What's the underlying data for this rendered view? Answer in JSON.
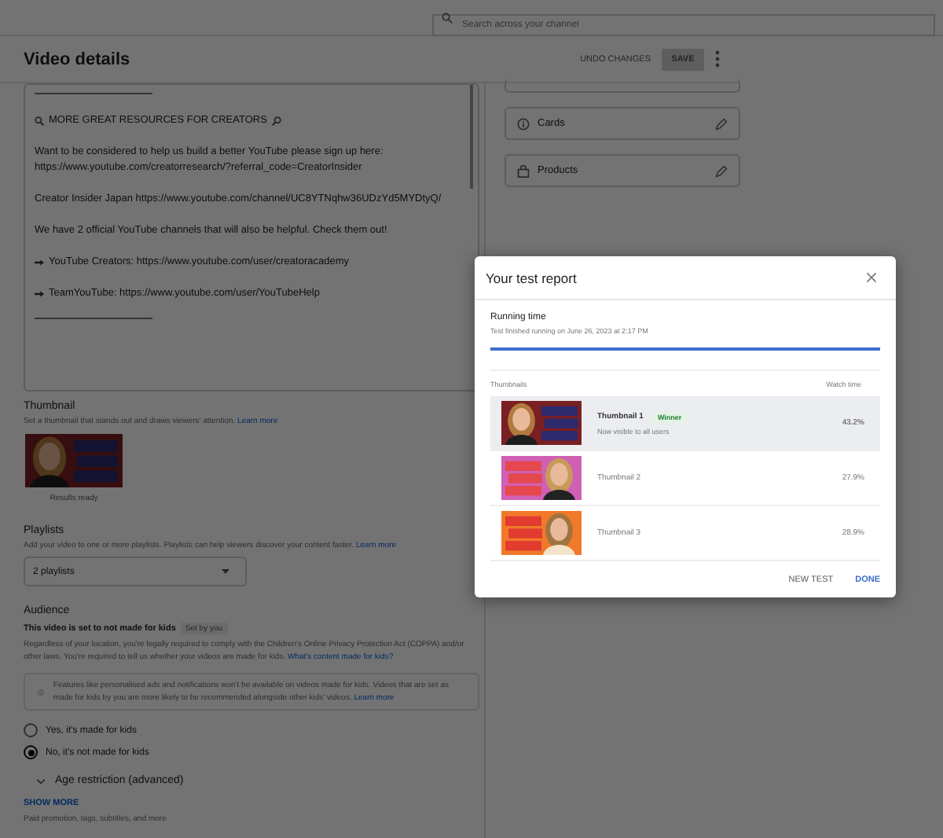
{
  "top_bar": {
    "search": {
      "placeholder": "Search across your channel"
    }
  },
  "header": {
    "title": "Video details",
    "undo": "UNDO CHANGES",
    "save": {
      "label": "SAVE",
      "disabled": true
    }
  },
  "description": {
    "paragraphs": [
      {
        "kind": "rule"
      },
      {
        "kind": "heading",
        "text": "MORE GREAT RESOURCES FOR CREATORS"
      },
      {
        "kind": "text",
        "lines": [
          "Want to be considered to help us build a better YouTube please sign up here:",
          "https://www.youtube.com/creatorresearch/?referral_code=CreatorInsider"
        ]
      },
      {
        "kind": "text",
        "lines": [
          "Creator Insider Japan https://www.youtube.com/channel/UC8YTNqhw36UDzYd5MYDtyQ/"
        ]
      },
      {
        "kind": "text",
        "lines": [
          "We have 2 official YouTube channels that will also be helpful. Check them out!"
        ]
      },
      {
        "kind": "bullet",
        "text": "YouTube Creators: https://www.youtube.com/user/creatoracademy"
      },
      {
        "kind": "bullet",
        "text": "TeamYouTube: https://www.youtube.com/user/YouTubeHelp"
      },
      {
        "kind": "rule"
      }
    ]
  },
  "side_cards": [
    {
      "kind": "cards",
      "label": "Cards"
    },
    {
      "kind": "products",
      "label": "Products"
    }
  ],
  "thumbnail": {
    "title": "Thumbnail",
    "hint": "Set a thumbnail that stands out and draws viewers' attention.",
    "link": "Learn more",
    "status": "Results ready"
  },
  "playlists": {
    "title": "Playlists",
    "hint": "Add your video to one or more playlists. Playlists can help viewers discover your content faster.",
    "link": "Learn more",
    "value": "2 playlists"
  },
  "audience": {
    "title": "Audience",
    "status": "This video is set to not made for kids",
    "badge": "Set by you",
    "paragraph": "Regardless of your location, you're legally required to comply with the Children's Online Privacy Protection Act (COPPA) and/or other laws. You're required to tell us whether your videos are made for kids.",
    "paragraph_link": "What's content made for kids?",
    "info": "Features like personalised ads and notifications won't be available on videos made for kids. Videos that are set as made for kids by you are more likely to be recommended alongside other kids' videos.",
    "info_link": "Learn more",
    "options": [
      {
        "label": "Yes, it's made for kids",
        "selected": false
      },
      {
        "label": "No, it's not made for kids",
        "selected": true
      }
    ]
  },
  "age_restriction": {
    "label": "Age restriction (advanced)",
    "expanded": false
  },
  "show_more": {
    "label": "SHOW MORE",
    "hint": "Paid promotion, tags, subtitles, and more"
  },
  "dialog": {
    "title": "Your test report",
    "running_time": {
      "title": "Running time",
      "subtitle": "Test finished running on June 26, 2023 at 2:17 PM",
      "level": 1
    },
    "columns": [
      "Thumbnails",
      "Watch time"
    ],
    "rows": [
      {
        "name": "Thumbnail 1",
        "badge": "Winner",
        "note": "Now visible to all users",
        "watch_time": "43.2%",
        "selected": true
      },
      {
        "name": "Thumbnail 2",
        "watch_time": "27.9%",
        "selected": false
      },
      {
        "name": "Thumbnail 3",
        "watch_time": "28.9%",
        "selected": false
      }
    ],
    "actions": [
      {
        "label": "NEW TEST",
        "primary": false
      },
      {
        "label": "DONE",
        "primary": true
      }
    ]
  }
}
